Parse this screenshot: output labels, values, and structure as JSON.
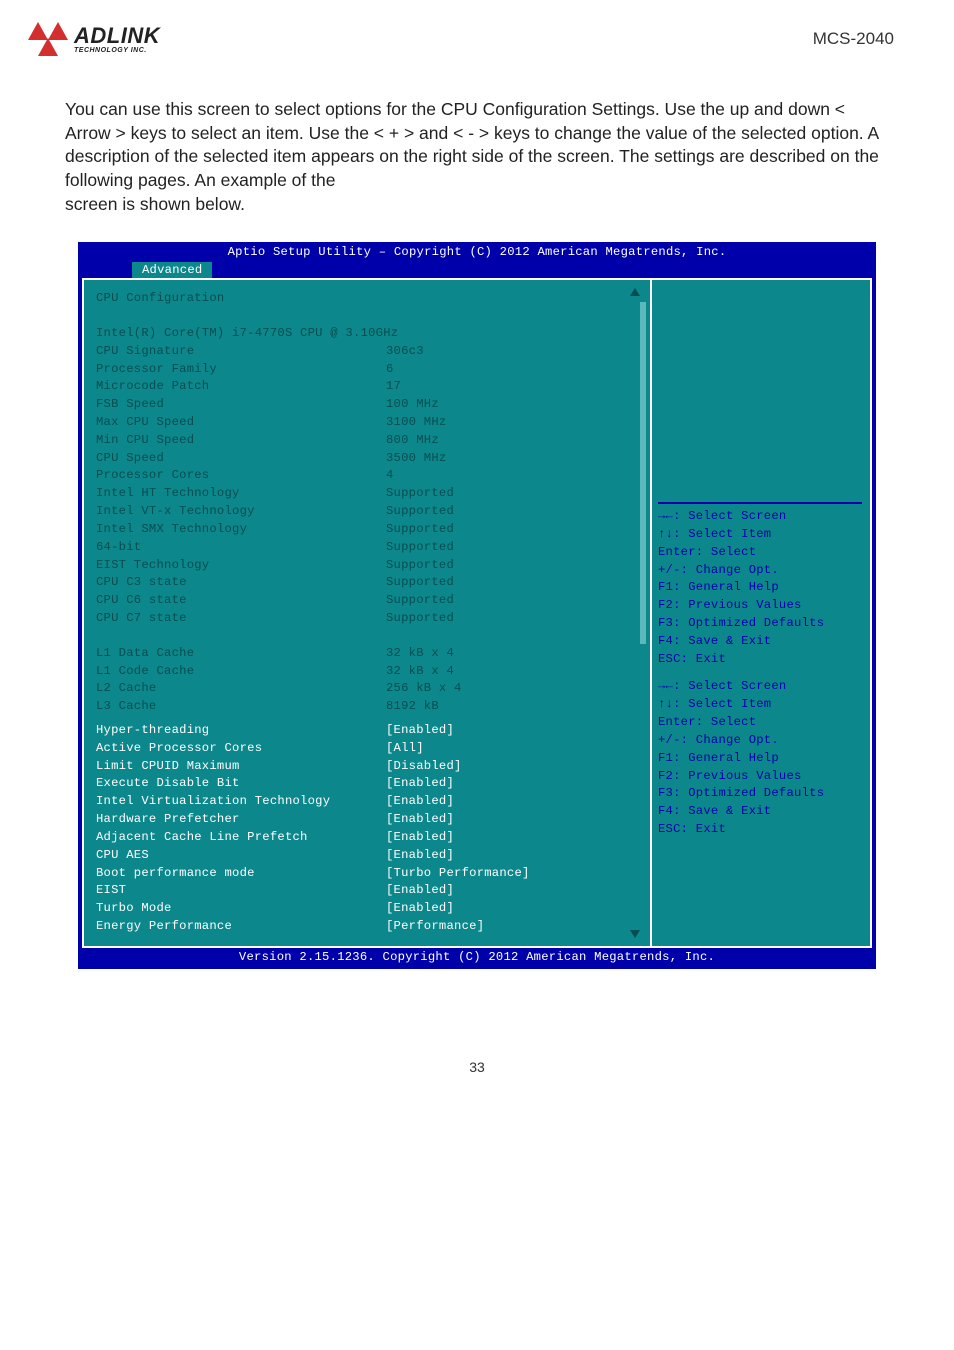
{
  "doc": {
    "label": "MCS-2040",
    "brand_name": "ADLINK",
    "brand_sub": "TECHNOLOGY INC."
  },
  "intro": "You can use this screen to select options for the CPU Configuration Settings. Use the up and down < Arrow > keys to select an item. Use the < + > and < - > keys to change the value of the selected option. A description of the selected item appears on the right side of the screen. The settings are described on the following pages. An example of the\nscreen is shown below.",
  "bios": {
    "title": "Aptio Setup Utility – Copyright (C) 2012 American Megatrends, Inc.",
    "tab": "Advanced",
    "footer": "Version 2.15.1236. Copyright (C) 2012 American Megatrends, Inc.",
    "section_title": "CPU Configuration",
    "cpu_name": "Intel(R) Core(TM) i7-4770S CPU @ 3.10GHz",
    "readonly_rows": [
      {
        "label": "CPU Signature",
        "value": "306c3"
      },
      {
        "label": "Processor Family",
        "value": "6"
      },
      {
        "label": "Microcode Patch",
        "value": "17"
      },
      {
        "label": "FSB Speed",
        "value": "100 MHz"
      },
      {
        "label": "Max CPU Speed",
        "value": "3100 MHz"
      },
      {
        "label": "Min CPU Speed",
        "value": "800 MHz"
      },
      {
        "label": "CPU Speed",
        "value": "3500 MHz"
      },
      {
        "label": "Processor Cores",
        "value": "4"
      },
      {
        "label": "Intel HT Technology",
        "value": "Supported"
      },
      {
        "label": "Intel VT-x Technology",
        "value": "Supported"
      },
      {
        "label": "Intel SMX Technology",
        "value": "Supported"
      },
      {
        "label": "64-bit",
        "value": "Supported"
      },
      {
        "label": "EIST Technology",
        "value": "Supported"
      },
      {
        "label": "CPU C3 state",
        "value": "Supported"
      },
      {
        "label": "CPU C6 state",
        "value": "Supported"
      },
      {
        "label": "CPU C7 state",
        "value": "Supported"
      }
    ],
    "cache_rows": [
      {
        "label": "L1 Data Cache",
        "value": "32 kB x 4"
      },
      {
        "label": "L1 Code Cache",
        "value": "32 kB x 4"
      },
      {
        "label": "L2 Cache",
        "value": "256 kB x 4"
      },
      {
        "label": "L3 Cache",
        "value": "8192 kB"
      }
    ],
    "option_rows": [
      {
        "label": "Hyper-threading",
        "value": "[Enabled]"
      },
      {
        "label": "Active Processor Cores",
        "value": "[All]"
      },
      {
        "label": "Limit CPUID Maximum",
        "value": "[Disabled]"
      },
      {
        "label": "Execute Disable Bit",
        "value": "[Enabled]"
      },
      {
        "label": "Intel Virtualization Technology",
        "value": "[Enabled]"
      },
      {
        "label": "Hardware Prefetcher",
        "value": "[Enabled]"
      },
      {
        "label": "Adjacent Cache Line Prefetch",
        "value": "[Enabled]"
      },
      {
        "label": "CPU AES",
        "value": "[Enabled]"
      },
      {
        "label": "Boot performance mode",
        "value": "[Turbo Performance]"
      },
      {
        "label": "EIST",
        "value": "[Enabled]"
      },
      {
        "label": "Turbo Mode",
        "value": "[Enabled]"
      },
      {
        "label": "Energy Performance",
        "value": "[Performance]"
      }
    ],
    "hints": [
      "→←: Select Screen",
      "↑↓: Select Item",
      "Enter: Select",
      "+/-: Change Opt.",
      "F1: General Help",
      "F2: Previous Values",
      "F3: Optimized Defaults",
      "F4: Save & Exit",
      "ESC: Exit"
    ]
  },
  "page": "33"
}
